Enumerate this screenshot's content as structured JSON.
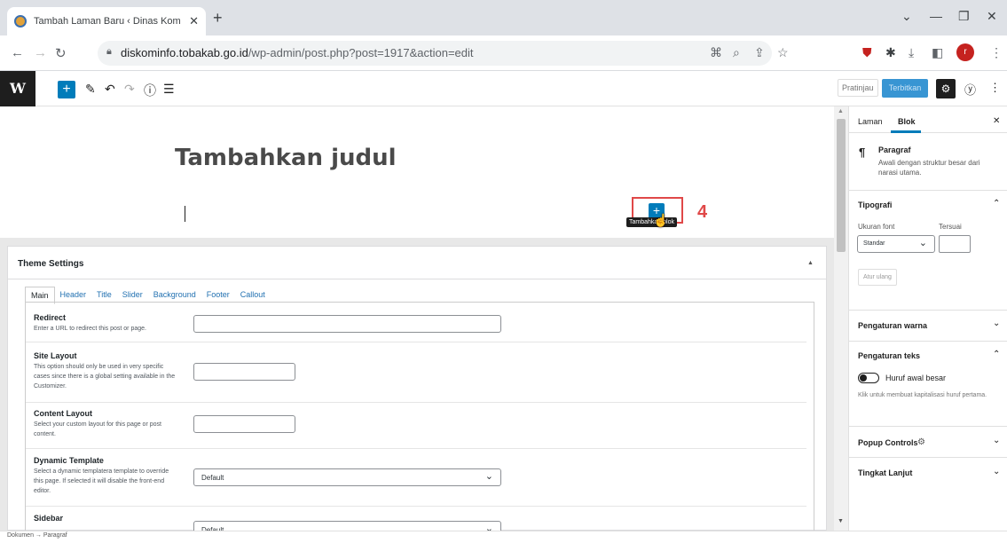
{
  "browser": {
    "tab_title": "Tambah Laman Baru ‹ Dinas Kom",
    "tab_close": "✕",
    "new_tab": "+",
    "url_host": "diskominfo.tobakab.go.id",
    "url_path": "/wp-admin/post.php?post=1917&action=edit",
    "profile_initial": "r"
  },
  "editor": {
    "logo": "W",
    "inserter": "+",
    "preview": "Pratinjau",
    "publish": "Terbitkan",
    "title_placeholder": "Tambahkan judul",
    "add_block_tooltip": "Tambahkan blok",
    "step_number": "4"
  },
  "theme_settings": {
    "title": "Theme Settings",
    "tabs": [
      "Main",
      "Header",
      "Title",
      "Slider",
      "Background",
      "Footer",
      "Callout"
    ],
    "fields": [
      {
        "label": "Redirect",
        "desc": "Enter a URL to redirect this post or page."
      },
      {
        "label": "Site Layout",
        "desc": "This option should only be used in very specific cases since there is a global setting available in the Customizer."
      },
      {
        "label": "Content Layout",
        "desc": "Select your custom layout for this page or post content."
      },
      {
        "label": "Dynamic Template",
        "desc": "Select a dynamic templatera template to override this page. If selected it will disable the front-end editor.",
        "value": "Default"
      },
      {
        "label": "Sidebar",
        "value": "Default"
      }
    ]
  },
  "sidebar": {
    "tab_page": "Laman",
    "tab_block": "Blok",
    "block_name": "Paragraf",
    "block_desc": "Awali dengan struktur besar dari narasi utama.",
    "typography": "Tipografi",
    "font_size_label": "Ukuran font",
    "custom_label": "Tersuai",
    "font_size_value": "Standar",
    "reset": "Atur ulang",
    "color_settings": "Pengaturan warna",
    "text_settings": "Pengaturan teks",
    "drop_cap": "Huruf awal besar",
    "drop_cap_help": "Klik untuk membuat kapitalisasi huruf pertama.",
    "popup_controls": "Popup Controls",
    "advanced": "Tingkat Lanjut"
  },
  "statusbar": {
    "breadcrumb": "Dokumen → Paragraf"
  },
  "colors": {
    "accent": "#007cba",
    "highlight": "#e04848"
  }
}
